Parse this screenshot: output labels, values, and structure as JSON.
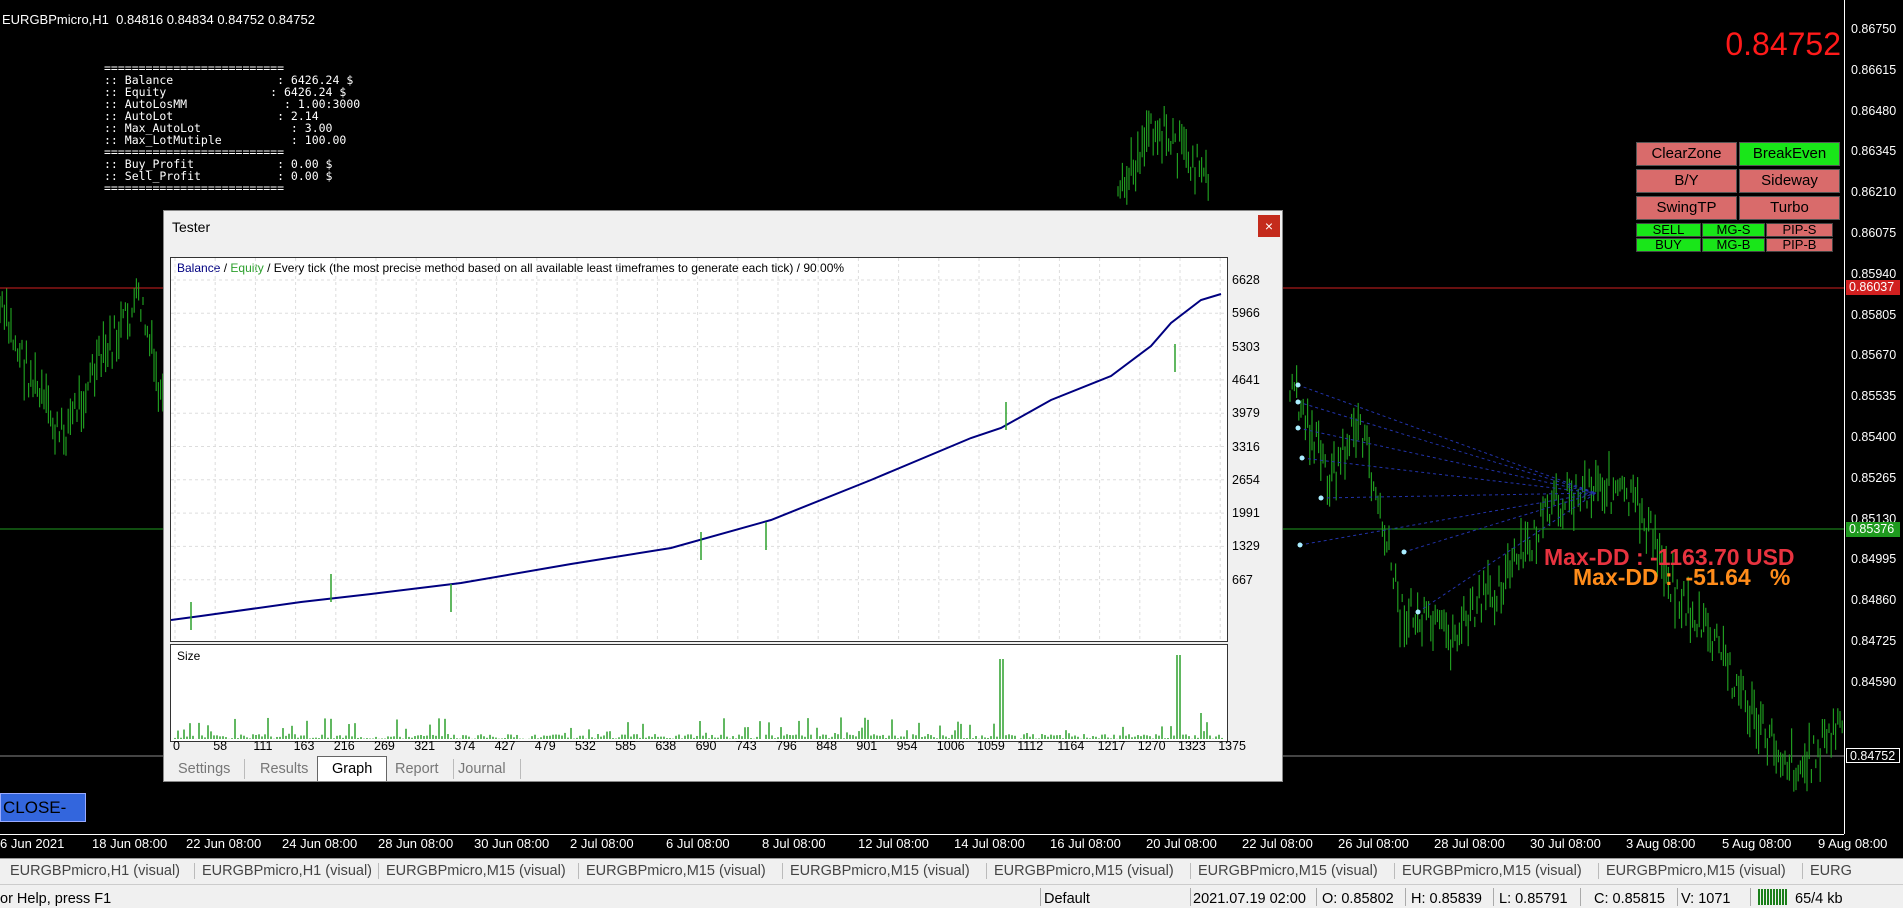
{
  "chart": {
    "header": "EURGBPmicro,H1  0.84816 0.84834 0.84752 0.84752",
    "current_price": "0.84752",
    "price_scale": [
      "0.86750",
      "0.86615",
      "0.86480",
      "0.86345",
      "0.86210",
      "0.86075",
      "0.85940",
      "0.85805",
      "0.85670",
      "0.85535",
      "0.85400",
      "0.85265",
      "0.85130",
      "0.84995",
      "0.84860",
      "0.84725",
      "0.84590"
    ],
    "price_tags": [
      {
        "value": "0.86037",
        "bg": "#d12020"
      },
      {
        "value": "0.85376",
        "bg": "#1f9a1f"
      },
      {
        "value": "0.84752",
        "bg": "#000000"
      }
    ],
    "time_scale": [
      "6 Jun 2021",
      "18 Jun 08:00",
      "22 Jun 08:00",
      "24 Jun 08:00",
      "28 Jun 08:00",
      "30 Jun 08:00",
      "2 Jul 08:00",
      "6 Jul 08:00",
      "8 Jul 08:00",
      "12 Jul 08:00",
      "14 Jul 08:00",
      "16 Jul 08:00",
      "20 Jul 08:00",
      "22 Jul 08:00",
      "26 Jul 08:00",
      "28 Jul 08:00",
      "30 Jul 08:00",
      "3 Aug 08:00",
      "5 Aug 08:00",
      "9 Aug 08:00"
    ],
    "candle_color": "#1f9a1f",
    "line_red": "#d12020",
    "line_green": "#1f9a1f"
  },
  "info_panel": {
    "lines": [
      "==========================",
      ":: Balance               : 6426.24 $",
      ":: Equity               : 6426.24 $",
      ":: AutoLosMM              : 1.00:3000",
      ":: AutoLot               : 2.14",
      ":: Max_AutoLot             : 3.00",
      ":: Max_LotMutiple          : 100.00",
      "==========================",
      ":: Buy_Profit            : 0.00 $",
      ":: Sell_Profit           : 0.00 $",
      "=========================="
    ]
  },
  "ea_buttons": [
    {
      "label": "ClearZone",
      "bg": "#d96b6b"
    },
    {
      "label": "BreakEven",
      "bg": "#19e619"
    },
    {
      "label": "B/Y",
      "bg": "#d96b6b"
    },
    {
      "label": "Sideway",
      "bg": "#d96b6b"
    },
    {
      "label": "SwingTP",
      "bg": "#d96b6b"
    },
    {
      "label": "Turbo",
      "bg": "#d96b6b"
    }
  ],
  "mini_buttons": [
    {
      "label": "SELL",
      "bg": "#19e619"
    },
    {
      "label": "MG-S",
      "bg": "#19e619"
    },
    {
      "label": "PIP-S",
      "bg": "#d96b6b"
    },
    {
      "label": "BUY",
      "bg": "#19e619"
    },
    {
      "label": "MG-B",
      "bg": "#19e619"
    },
    {
      "label": "PIP-B",
      "bg": "#d96b6b"
    }
  ],
  "drawdown": {
    "usd": "Max-DD : -1163.70 USD",
    "pct": "Max-DD :  -51.64   %"
  },
  "close_all": "CLOSE-ALL",
  "tester": {
    "title": "Tester",
    "close": "×",
    "graph_header_balance": "Balance",
    "graph_header_sep": " / ",
    "graph_header_equity": "Equity",
    "graph_header_rest": " / Every tick (the most precise method based on all available least timeframes to generate each tick) / 90.00%",
    "size_label": "Size",
    "y_axis": [
      "6628",
      "5966",
      "5303",
      "4641",
      "3979",
      "3316",
      "2654",
      "1991",
      "1329",
      "667"
    ],
    "x_axis": [
      "0",
      "58",
      "111",
      "163",
      "216",
      "269",
      "321",
      "374",
      "427",
      "479",
      "532",
      "585",
      "638",
      "690",
      "743",
      "796",
      "848",
      "901",
      "954",
      "1006",
      "1059",
      "1112",
      "1164",
      "1217",
      "1270",
      "1323",
      "1375"
    ],
    "tabs": [
      "Settings",
      "Results",
      "Graph",
      "Report",
      "Journal"
    ],
    "active_tab": "Graph",
    "balance_color": "#000080",
    "equity_color": "#2ca02c"
  },
  "chart_tabs": [
    "EURGBPmicro,H1 (visual)",
    "EURGBPmicro,H1 (visual)",
    "EURGBPmicro,M15 (visual)",
    "EURGBPmicro,M15 (visual)",
    "EURGBPmicro,M15 (visual)",
    "EURGBPmicro,M15 (visual)",
    "EURGBPmicro,M15 (visual)",
    "EURGBPmicro,M15 (visual)",
    "EURGBPmicro,M15 (visual)",
    "EURG"
  ],
  "status": {
    "help": "or Help, press F1",
    "profile": "Default",
    "time": "2021.07.19 02:00",
    "open": "O: 0.85802",
    "high": "H: 0.85839",
    "low": "L: 0.85791",
    "close": "C: 0.85815",
    "volume": "V: 1071",
    "traffic": "65/4 kb"
  }
}
